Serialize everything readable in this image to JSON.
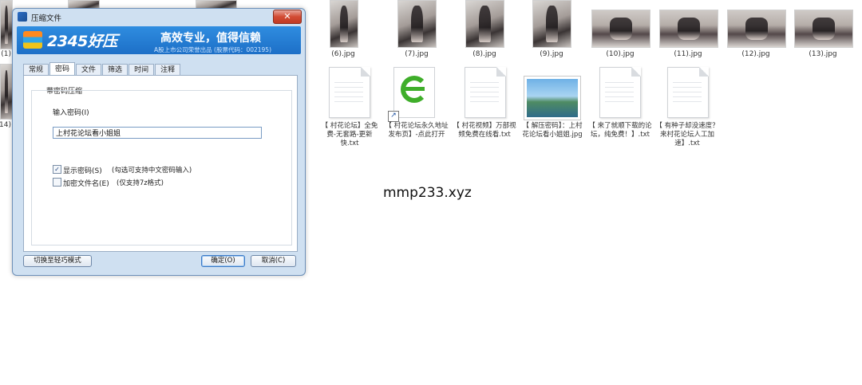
{
  "explorer": {
    "row1": [
      {
        "name": "(6).jpg"
      },
      {
        "name": "(7).jpg"
      },
      {
        "name": "(8).jpg"
      },
      {
        "name": "(9).jpg"
      },
      {
        "name": "(10).jpg"
      },
      {
        "name": "(11).jpg"
      },
      {
        "name": "(12).jpg"
      },
      {
        "name": "(13).jpg"
      }
    ],
    "left_cut_labels": [
      "(1)",
      "14)"
    ],
    "row2": [
      {
        "name": "【 村花论坛】全免费-无套路-更新快.txt",
        "type": "txt"
      },
      {
        "name": "【 村花论坛永久地址发布页】-点此打开",
        "type": "url"
      },
      {
        "name": "【 村花视频】万部视频免费在线看.txt",
        "type": "txt"
      },
      {
        "name": "【 解压密码】：上村花论坛看小姐姐.jpg",
        "type": "jpg"
      },
      {
        "name": "【 来了就顺下载的论坛，纯免费！】.txt",
        "type": "txt"
      },
      {
        "name": "【 有种子却没速度？来村花论坛人工加速】.txt",
        "type": "txt"
      }
    ],
    "watermark": "mmp233.xyz"
  },
  "dialog": {
    "title": "压缩文件",
    "close_label": "✕",
    "banner": {
      "brand": "2345好压",
      "slogan": "高效专业，值得信赖",
      "subline": "A股上市公司荣誉出品 (股票代码：002195)"
    },
    "tabs": [
      "常规",
      "密码",
      "文件",
      "筛选",
      "时间",
      "注释"
    ],
    "active_tab": "密码",
    "group_title": "带密码压缩",
    "password_label": "输入密码(I)",
    "password_value": "上村花论坛看小姐姐",
    "show_password_label": "显示密码(S)",
    "show_password_hint": "(勾选可支持中文密码输入)",
    "show_password_checked": true,
    "encrypt_names_label": "加密文件名(E)",
    "encrypt_names_hint": "(仅支持7z格式)",
    "encrypt_names_checked": false,
    "switch_mode_label": "切换至轻巧模式",
    "ok_label": "确定(O)",
    "cancel_label": "取消(C)"
  }
}
